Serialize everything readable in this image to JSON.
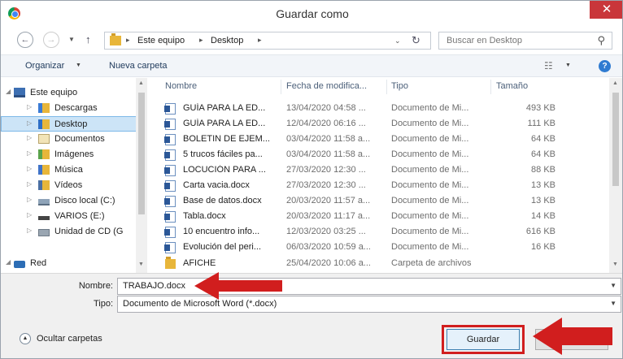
{
  "window": {
    "title": "Guardar como",
    "close": "✕"
  },
  "nav": {
    "back": "←",
    "forward": "→",
    "up": "↑",
    "breadcrumb": [
      "Este equipo",
      "Desktop"
    ],
    "search_placeholder": "Buscar en Desktop"
  },
  "toolbar": {
    "organize": "Organizar",
    "new_folder": "Nueva carpeta",
    "help": "?"
  },
  "tree": [
    {
      "label": "Este equipo",
      "icon": "computer-icon"
    },
    {
      "label": "Descargas",
      "icon": "downloads-folder-icon"
    },
    {
      "label": "Desktop",
      "icon": "desktop-folder-icon",
      "selected": true
    },
    {
      "label": "Documentos",
      "icon": "documents-folder-icon"
    },
    {
      "label": "Imágenes",
      "icon": "pictures-folder-icon"
    },
    {
      "label": "Música",
      "icon": "music-folder-icon"
    },
    {
      "label": "Vídeos",
      "icon": "videos-folder-icon"
    },
    {
      "label": "Disco local (C:)",
      "icon": "local-disk-icon"
    },
    {
      "label": "VARIOS (E:)",
      "icon": "drive-icon"
    },
    {
      "label": "Unidad de CD (G",
      "icon": "cd-drive-icon"
    },
    {
      "label": "Red",
      "icon": "network-icon"
    }
  ],
  "columns": {
    "name": "Nombre",
    "date": "Fecha de modifica...",
    "type": "Tipo",
    "size": "Tamaño"
  },
  "files": [
    {
      "name": "GUÍA PARA LA ED...",
      "date": "13/04/2020 04:58 ...",
      "type": "Documento de Mi...",
      "size": "493 KB"
    },
    {
      "name": "GUÍA PARA LA ED...",
      "date": "12/04/2020 06:16 ...",
      "type": "Documento de Mi...",
      "size": "111 KB"
    },
    {
      "name": "BOLETIN DE EJEM...",
      "date": "03/04/2020 11:58 a...",
      "type": "Documento de Mi...",
      "size": "64 KB"
    },
    {
      "name": "5 trucos fáciles pa...",
      "date": "03/04/2020 11:58 a...",
      "type": "Documento de Mi...",
      "size": "64 KB"
    },
    {
      "name": "LOCUCIÓN PARA ...",
      "date": "27/03/2020 12:30 ...",
      "type": "Documento de Mi...",
      "size": "88 KB"
    },
    {
      "name": "Carta vacia.docx",
      "date": "27/03/2020 12:30 ...",
      "type": "Documento de Mi...",
      "size": "13 KB"
    },
    {
      "name": "Base de datos.docx",
      "date": "20/03/2020 11:57 a...",
      "type": "Documento de Mi...",
      "size": "13 KB"
    },
    {
      "name": "Tabla.docx",
      "date": "20/03/2020 11:17 a...",
      "type": "Documento de Mi...",
      "size": "14 KB"
    },
    {
      "name": "10 encuentro info...",
      "date": "12/03/2020 03:25 ...",
      "type": "Documento de Mi...",
      "size": "616 KB"
    },
    {
      "name": "Evolución del peri...",
      "date": "06/03/2020 10:59 a...",
      "type": "Documento de Mi...",
      "size": "16 KB"
    },
    {
      "name": "AFICHE",
      "date": "25/04/2020 10:06 a...",
      "type": "Carpeta de archivos",
      "size": "",
      "folder": true
    }
  ],
  "form": {
    "filename_label": "Nombre:",
    "filename_value": "TRABAJO.docx",
    "type_label": "Tipo:",
    "type_value": "Documento de Microsoft Word (*.docx)"
  },
  "footer": {
    "hide_folders": "Ocultar carpetas",
    "save": "Guardar"
  },
  "colors": {
    "annotation": "#d11e1e",
    "close_button": "#c9363a",
    "selection": "#cce4f7"
  }
}
